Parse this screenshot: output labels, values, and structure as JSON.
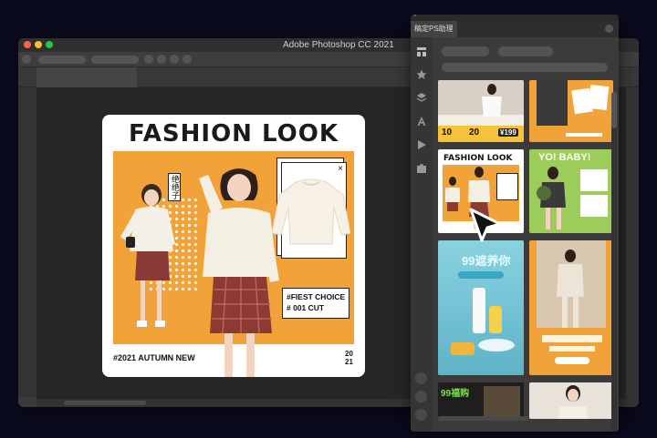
{
  "window": {
    "title": "Adobe Photoshop CC 2021"
  },
  "poster": {
    "title": "FASHION LOOK",
    "vertical_label": "绝绝子",
    "choice_line1": "#FIEST CHOICE",
    "choice_line2": "#    001 CUT",
    "footer": "#2021 AUTUMN NEW",
    "year_top": "20",
    "year_bottom": "21",
    "close_glyph": "×"
  },
  "panel": {
    "tab_title": "稿定PS助理",
    "close_glyph": "×",
    "side_icons": [
      "layout-icon",
      "star-icon",
      "layers-icon",
      "text-icon",
      "play-icon",
      "puzzle-icon"
    ],
    "thumbs": {
      "t1_badge1": "10",
      "t1_badge2": "20",
      "t1_price": "¥199",
      "t3_title": "FASHION LOOK",
      "t4_title": "YO! BABY!",
      "t5_title": "99遮养你",
      "t7_title": "99福购"
    }
  },
  "colors": {
    "accent_orange": "#f1a33a",
    "background": "#0b0b1f",
    "panel": "#3b3b3b",
    "green": "#9ccc5a",
    "teal": "#7fc6d6"
  }
}
